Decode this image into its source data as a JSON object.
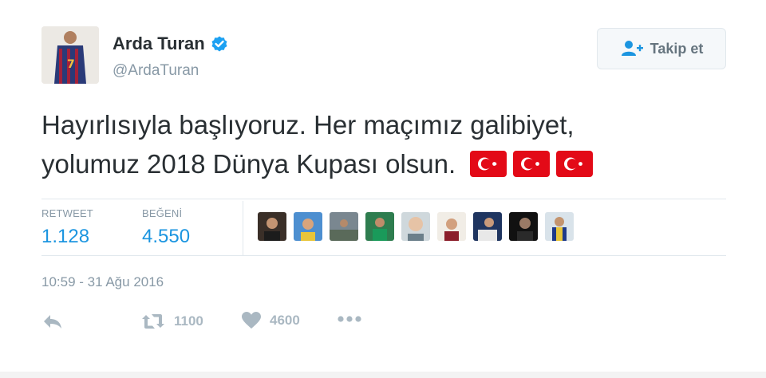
{
  "author": {
    "name": "Arda Turan",
    "handle": "@ArdaTuran",
    "verified": true,
    "avatar_icon": "avatar-jersey-icon"
  },
  "follow_button": {
    "label": "Takip et",
    "icon": "add-user-icon"
  },
  "tweet": {
    "line1": "Hayırlısıyla başlıyoruz. Her maçımız galibiyet,",
    "line2": "yolumuz 2018 Dünya Kupası olsun.",
    "emoji": [
      "flag-turkey-icon",
      "flag-turkey-icon",
      "flag-turkey-icon"
    ]
  },
  "stats": {
    "retweet_label": "RETWEET",
    "retweet_value": "1.128",
    "likes_label": "BEĞENİ",
    "likes_value": "4.550"
  },
  "timestamp": "10:59 - 31 Ağu 2016",
  "actions": {
    "reply_icon": "reply-icon",
    "retweet_count": "1100",
    "like_count": "4600",
    "more_icon": "more-icon"
  },
  "colors": {
    "accent": "#1b95e0",
    "muted": "#8899a6",
    "verified": "#1da1f2",
    "flag_red": "#e30a17"
  }
}
